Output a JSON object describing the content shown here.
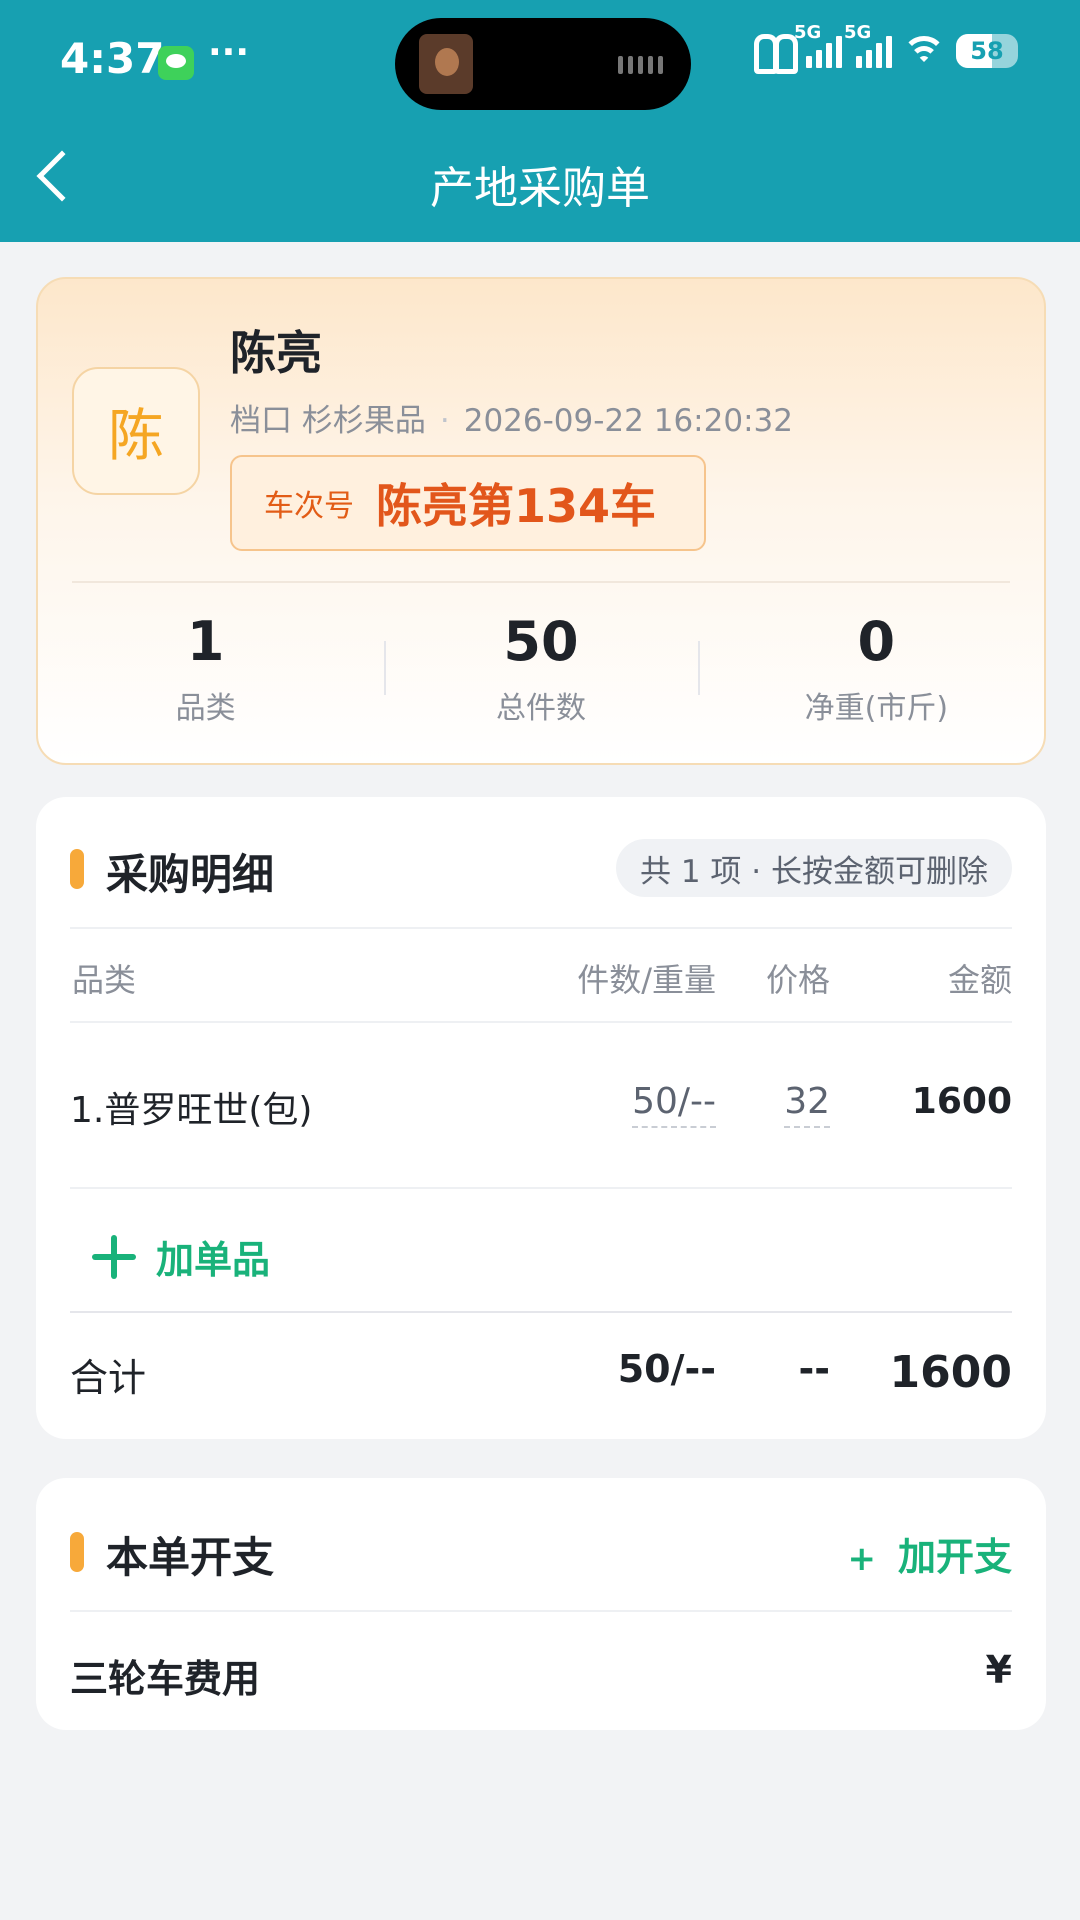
{
  "status_bar": {
    "time": "4:37",
    "dots": "···",
    "net1": "5G",
    "net2": "5G",
    "battery": "58"
  },
  "header": {
    "title": "产地采购单"
  },
  "profile": {
    "avatar_char": "陈",
    "name": "陈亮",
    "stall": "档口 杉杉果品",
    "separator": "·",
    "datetime": "2026-09-22 16:20:32",
    "trip_label": "车次号",
    "trip_value": "陈亮第134车",
    "stats": [
      {
        "value": "1",
        "label": "品类"
      },
      {
        "value": "50",
        "label": "总件数"
      },
      {
        "value": "0",
        "label": "净重(市斤)"
      }
    ]
  },
  "detail": {
    "title": "采购明细",
    "hint": "共 1 项 · 长按金额可删除",
    "columns": {
      "category": "品类",
      "qty": "件数/重量",
      "price": "价格",
      "amount": "金额"
    },
    "rows": [
      {
        "name": "1.普罗旺世(包)",
        "qty": "50/--",
        "price": "32",
        "amount": "1600"
      }
    ],
    "add_label": "加单品",
    "total": {
      "label": "合计",
      "qty": "50/--",
      "price": "--",
      "amount": "1600"
    }
  },
  "expenses": {
    "title": "本单开支",
    "add_plus": "+",
    "add_label": "加开支",
    "items": [
      {
        "name": "三轮车费用",
        "currency": "¥"
      }
    ]
  }
}
